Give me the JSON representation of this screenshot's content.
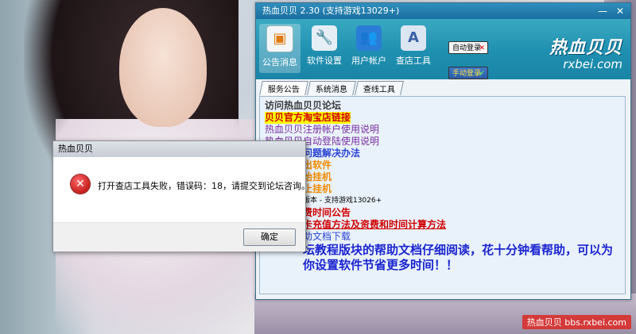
{
  "app": {
    "title": "热血贝贝 2.30  (支持游戏13029+)",
    "window_buttons": {
      "minimize": "—",
      "close": "✕"
    },
    "toolbar": [
      {
        "label": "公告消息",
        "icon": "notice-icon"
      },
      {
        "label": "软件设置",
        "icon": "wrench-icon"
      },
      {
        "label": "用户帐户",
        "icon": "users-icon"
      },
      {
        "label": "查店工具",
        "icon": "appstore-icon"
      }
    ],
    "login": {
      "auto": "自动登录",
      "manual": "手动登录"
    },
    "brand": {
      "logo": "热血贝贝",
      "url": "rxbei.com"
    },
    "tabs": [
      "服务公告",
      "系统消息",
      "查线工具"
    ],
    "content": {
      "line1": "访问热血贝贝论坛",
      "line2": "贝贝官方淘宝店链接",
      "line3": "热血贝贝注册帐户使用说明",
      "line4": "热血贝贝自动登陆使用说明",
      "line5": "问题解决办法",
      "line6": "出软件",
      "line7": "始挂机",
      "line8": "止挂机",
      "line9": "版本 - 支持游戏13026+",
      "line10": "费时间公告",
      "line11": "卡充值方法及资费和时间计算方法",
      "line12": "助文档下载",
      "line13": "坛教程版块的帮助文档仔细阅读，花十分钟看帮助，可以为你设置软件节省更多时间！！"
    }
  },
  "dialog": {
    "title": "热血贝贝",
    "message": "打开查店工具失败，错误码：18，请提交到论坛咨询。",
    "ok": "确定"
  },
  "watermark": "热血贝贝 bbs.rxbei.com",
  "colors": {
    "toolbar": "#1f8fb0",
    "title_bar": "#1a6e9f",
    "error": "#c51d1d",
    "highlight_yellow": "#ffff00"
  }
}
